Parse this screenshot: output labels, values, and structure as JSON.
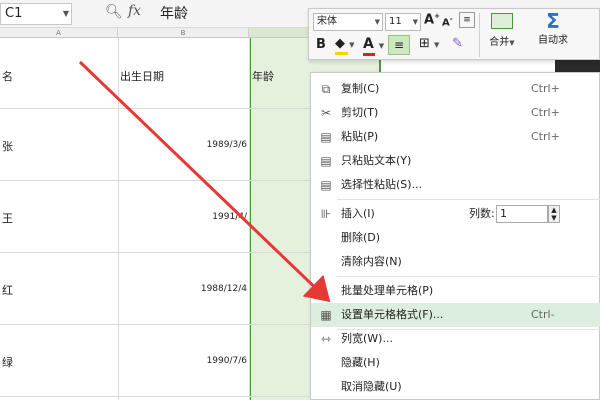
{
  "formula_bar": {
    "name_box": "C1",
    "formula": "年龄"
  },
  "columns": {
    "a": "A",
    "b": "B"
  },
  "header_row": {
    "name": "名",
    "dob": "出生日期",
    "age": "年龄"
  },
  "rows": [
    {
      "name": "张",
      "dob": "1989/3/6"
    },
    {
      "name": "王",
      "dob": "1991/4/"
    },
    {
      "name": "红",
      "dob": "1988/12/4"
    },
    {
      "name": "绿",
      "dob": "1990/7/6"
    }
  ],
  "toolbar": {
    "font": "宋体",
    "size": "11",
    "grow": "A",
    "shrink": "A",
    "bold": "B",
    "color": "A",
    "merge": "合并",
    "autosum": "自动求"
  },
  "context_menu": {
    "copy": "复制(C)",
    "copy_sc": "Ctrl+",
    "cut": "剪切(T)",
    "cut_sc": "Ctrl+",
    "paste": "粘贴(P)",
    "paste_sc": "Ctrl+",
    "paste_text": "只粘贴文本(Y)",
    "paste_special": "选择性粘贴(S)...",
    "insert": "插入(I)",
    "col_count_label": "列数:",
    "col_count": "1",
    "delete": "删除(D)",
    "clear": "清除内容(N)",
    "batch": "批量处理单元格(P)",
    "format_cells": "设置单元格格式(F)...",
    "format_sc": "Ctrl-",
    "col_width": "列宽(W)...",
    "hide": "隐藏(H)",
    "unhide": "取消隐藏(U)"
  },
  "colors": {
    "selection_border": "#4b9a3a",
    "selection_fill": "#e6f1dd",
    "arrow": "#e53935",
    "menu_highlight": "#dceedd"
  }
}
